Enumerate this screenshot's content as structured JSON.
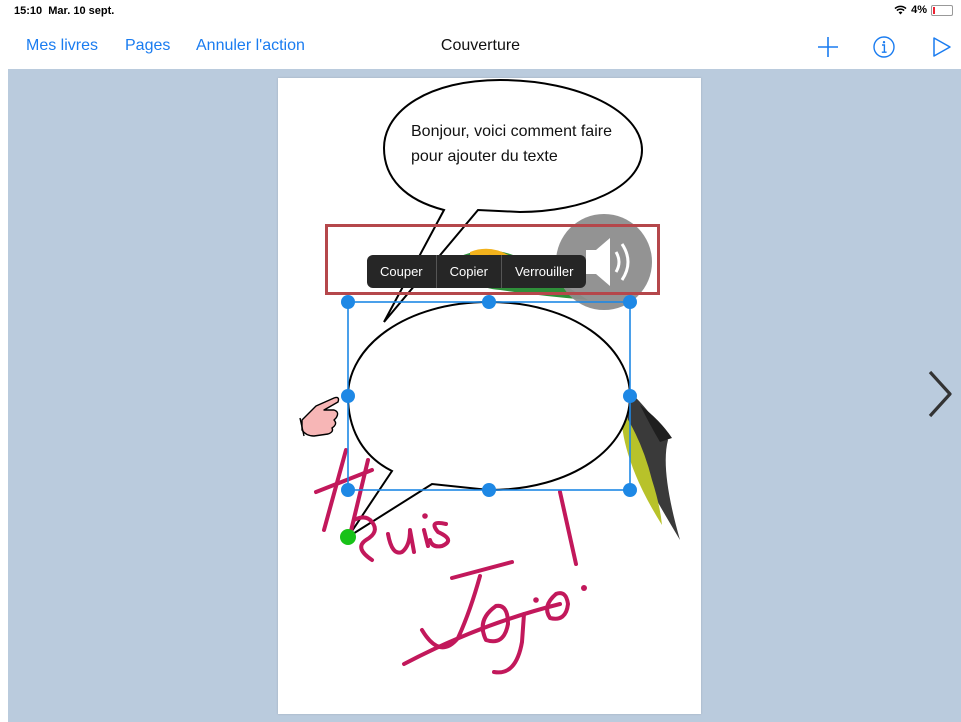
{
  "status": {
    "time": "15:10",
    "date": "Mar. 10 sept.",
    "battery_text": "4%",
    "icons": [
      "wifi-icon",
      "battery-icon"
    ]
  },
  "navbar": {
    "my_books": "Mes livres",
    "pages": "Pages",
    "undo": "Annuler l'action",
    "title": "Couverture",
    "icons": [
      "plus-icon",
      "info-icon",
      "play-icon"
    ],
    "accent_color": "#1a7cf0"
  },
  "page": {
    "bubble_text": "Bonjour, voici comment faire pour ajouter du texte",
    "handwriting": "Je suis Jojo !"
  },
  "context_menu": {
    "items": [
      "Couper",
      "Copier",
      "Verrouiller"
    ]
  },
  "colors": {
    "workspace_bg": "#bacbdd",
    "selection": "#1e88e5",
    "highlight": "#b5474b",
    "handwriting": "#c2185b"
  }
}
